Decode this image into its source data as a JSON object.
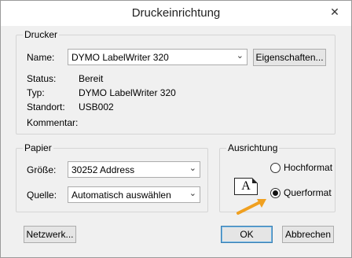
{
  "window": {
    "title": "Druckeinrichtung",
    "close_glyph": "✕"
  },
  "printer": {
    "legend": "Drucker",
    "name_label": "Name:",
    "name_value": "DYMO LabelWriter 320",
    "properties_button": "Eigenschaften...",
    "status_label": "Status:",
    "status_value": "Bereit",
    "type_label": "Typ:",
    "type_value": "DYMO LabelWriter 320",
    "location_label": "Standort:",
    "location_value": "USB002",
    "comment_label": "Kommentar:",
    "comment_value": ""
  },
  "paper": {
    "legend": "Papier",
    "size_label": "Größe:",
    "size_value": "30252 Address",
    "source_label": "Quelle:",
    "source_value": "Automatisch auswählen"
  },
  "orientation": {
    "legend": "Ausrichtung",
    "icon_letter": "A",
    "portrait_label": "Hochformat",
    "landscape_label": "Querformat",
    "selected": "landscape",
    "arrow_color": "#f0a020"
  },
  "buttons": {
    "network": "Netzwerk...",
    "ok": "OK",
    "cancel": "Abbrechen"
  }
}
